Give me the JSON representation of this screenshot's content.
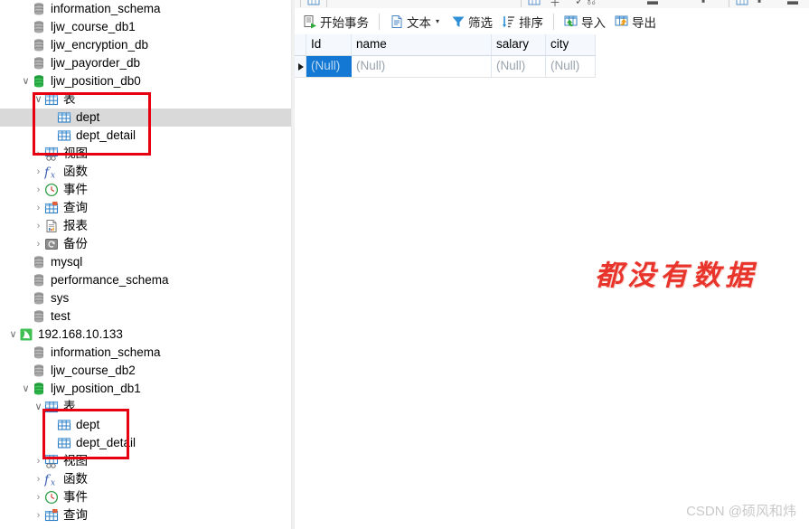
{
  "sidebar": {
    "name": "navicat-object-tree",
    "items": [
      {
        "label": "information_schema",
        "icon": "database-icon",
        "indent": 0,
        "twisty": "none",
        "selected": false
      },
      {
        "label": "ljw_course_db1",
        "icon": "database-icon",
        "indent": 0,
        "twisty": "none",
        "selected": false
      },
      {
        "label": "ljw_encryption_db",
        "icon": "database-icon",
        "indent": 0,
        "twisty": "none",
        "selected": false
      },
      {
        "label": "ljw_payorder_db",
        "icon": "database-icon",
        "indent": 0,
        "twisty": "none",
        "selected": false
      },
      {
        "label": "ljw_position_db0",
        "icon": "database-open-icon",
        "indent": 0,
        "twisty": "expanded",
        "selected": false
      },
      {
        "label": "表",
        "icon": "tables-folder-icon",
        "indent": 1,
        "twisty": "expanded",
        "selected": false
      },
      {
        "label": "dept",
        "icon": "table-icon",
        "indent": 2,
        "twisty": "none",
        "selected": true
      },
      {
        "label": "dept_detail",
        "icon": "table-icon",
        "indent": 2,
        "twisty": "none",
        "selected": false
      },
      {
        "label": "视图",
        "icon": "views-folder-icon",
        "indent": 1,
        "twisty": "collapsed",
        "selected": false
      },
      {
        "label": "函数",
        "icon": "function-icon",
        "indent": 1,
        "twisty": "collapsed",
        "selected": false
      },
      {
        "label": "事件",
        "icon": "event-clock-icon",
        "indent": 1,
        "twisty": "collapsed",
        "selected": false
      },
      {
        "label": "查询",
        "icon": "query-icon",
        "indent": 1,
        "twisty": "collapsed",
        "selected": false
      },
      {
        "label": "报表",
        "icon": "report-icon",
        "indent": 1,
        "twisty": "collapsed",
        "selected": false
      },
      {
        "label": "备份",
        "icon": "backup-icon",
        "indent": 1,
        "twisty": "collapsed",
        "selected": false
      },
      {
        "label": "mysql",
        "icon": "database-icon",
        "indent": 0,
        "twisty": "none",
        "selected": false
      },
      {
        "label": "performance_schema",
        "icon": "database-icon",
        "indent": 0,
        "twisty": "none",
        "selected": false
      },
      {
        "label": "sys",
        "icon": "database-icon",
        "indent": 0,
        "twisty": "none",
        "selected": false
      },
      {
        "label": "test",
        "icon": "database-icon",
        "indent": 0,
        "twisty": "none",
        "selected": false
      },
      {
        "label": "192.168.10.133",
        "icon": "mysql-connection-icon",
        "indent": -1,
        "twisty": "expanded",
        "selected": false
      },
      {
        "label": "information_schema",
        "icon": "database-icon",
        "indent": 0,
        "twisty": "none",
        "selected": false
      },
      {
        "label": "ljw_course_db2",
        "icon": "database-icon",
        "indent": 0,
        "twisty": "none",
        "selected": false
      },
      {
        "label": "ljw_position_db1",
        "icon": "database-open-icon",
        "indent": 0,
        "twisty": "expanded",
        "selected": false
      },
      {
        "label": "表",
        "icon": "tables-folder-icon",
        "indent": 1,
        "twisty": "expanded",
        "selected": false
      },
      {
        "label": "dept",
        "icon": "table-icon",
        "indent": 2,
        "twisty": "none",
        "selected": false
      },
      {
        "label": "dept_detail",
        "icon": "table-icon",
        "indent": 2,
        "twisty": "none",
        "selected": false
      },
      {
        "label": "视图",
        "icon": "views-folder-icon",
        "indent": 1,
        "twisty": "collapsed",
        "selected": false
      },
      {
        "label": "函数",
        "icon": "function-icon",
        "indent": 1,
        "twisty": "collapsed",
        "selected": false
      },
      {
        "label": "事件",
        "icon": "event-clock-icon",
        "indent": 1,
        "twisty": "collapsed",
        "selected": false
      },
      {
        "label": "查询",
        "icon": "query-icon",
        "indent": 1,
        "twisty": "collapsed",
        "selected": false
      }
    ]
  },
  "toolbar": {
    "begin_transaction_label": "开始事务",
    "text_label": "文本",
    "text_caret": "▾",
    "filter_label": "筛选",
    "sort_label": "排序",
    "import_label": "导入",
    "export_label": "导出"
  },
  "clipped_toolbar": {
    "visible": true,
    "note": "partially cut-off toolbar row at top edge"
  },
  "grid": {
    "columns": [
      "Id",
      "name",
      "salary",
      "city"
    ],
    "rows": [
      {
        "cells": [
          "(Null)",
          "(Null)",
          "(Null)",
          "(Null)"
        ],
        "selected_column": 0,
        "current": true
      }
    ]
  },
  "annotation": {
    "red_note": "都没有数据",
    "highlight_color": "#e60012"
  },
  "watermark": {
    "text": "CSDN @硕风和炜"
  }
}
